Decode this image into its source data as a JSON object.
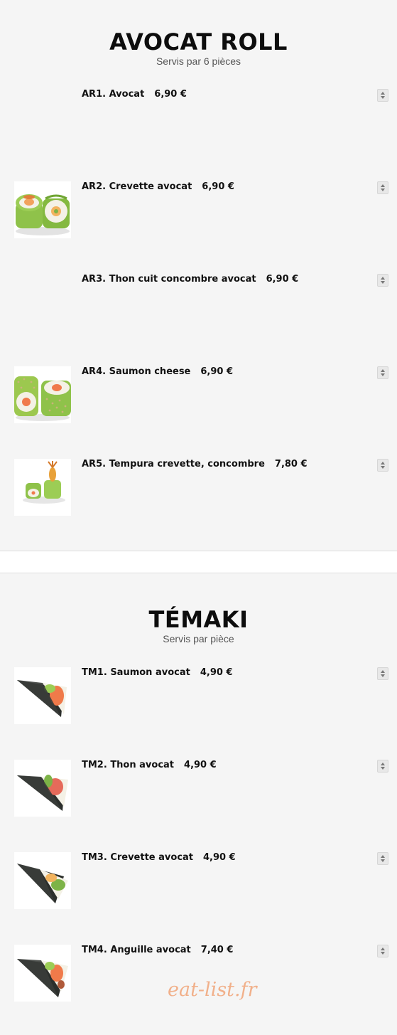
{
  "sections": [
    {
      "title": "AVOCAT ROLL",
      "subtitle": "Servis par 6 pièces",
      "items": [
        {
          "label": "AR1. Avocat",
          "price": "6,90 €",
          "image": "none"
        },
        {
          "label": "AR2. Crevette avocat",
          "price": "6,90 €",
          "image": "avocado-roll-shrimp-thumbnail"
        },
        {
          "label": "AR3. Thon cuit concombre avocat",
          "price": "6,90 €",
          "image": "none"
        },
        {
          "label": "AR4. Saumon cheese",
          "price": "6,90 €",
          "image": "avocado-roll-salmon-sesame-thumbnail"
        },
        {
          "label": "AR5. Tempura crevette, concombre",
          "price": "7,80 €",
          "image": "avocado-roll-tempura-thumbnail"
        }
      ]
    },
    {
      "title": "TÉMAKI",
      "subtitle": "Servis par pièce",
      "items": [
        {
          "label": "TM1. Saumon avocat",
          "price": "4,90 €",
          "image": "temaki-cone-thumbnail"
        },
        {
          "label": "TM2. Thon avocat",
          "price": "4,90 €",
          "image": "temaki-cone-thumbnail"
        },
        {
          "label": "TM3. Crevette avocat",
          "price": "4,90 €",
          "image": "temaki-cone-thumbnail"
        },
        {
          "label": "TM4. Anguille avocat",
          "price": "7,40 €",
          "image": "temaki-cone-thumbnail"
        }
      ]
    }
  ],
  "quantity_control_icon": "up-down-spinner-icon",
  "watermark": "eat-list.fr",
  "colors": {
    "background": "#f5f5f5",
    "divider": "#ffffff",
    "watermark": "#f1a97f",
    "avocado": "#8fc24a",
    "nori": "#2c2f2c",
    "salmon": "#f07a4a"
  }
}
